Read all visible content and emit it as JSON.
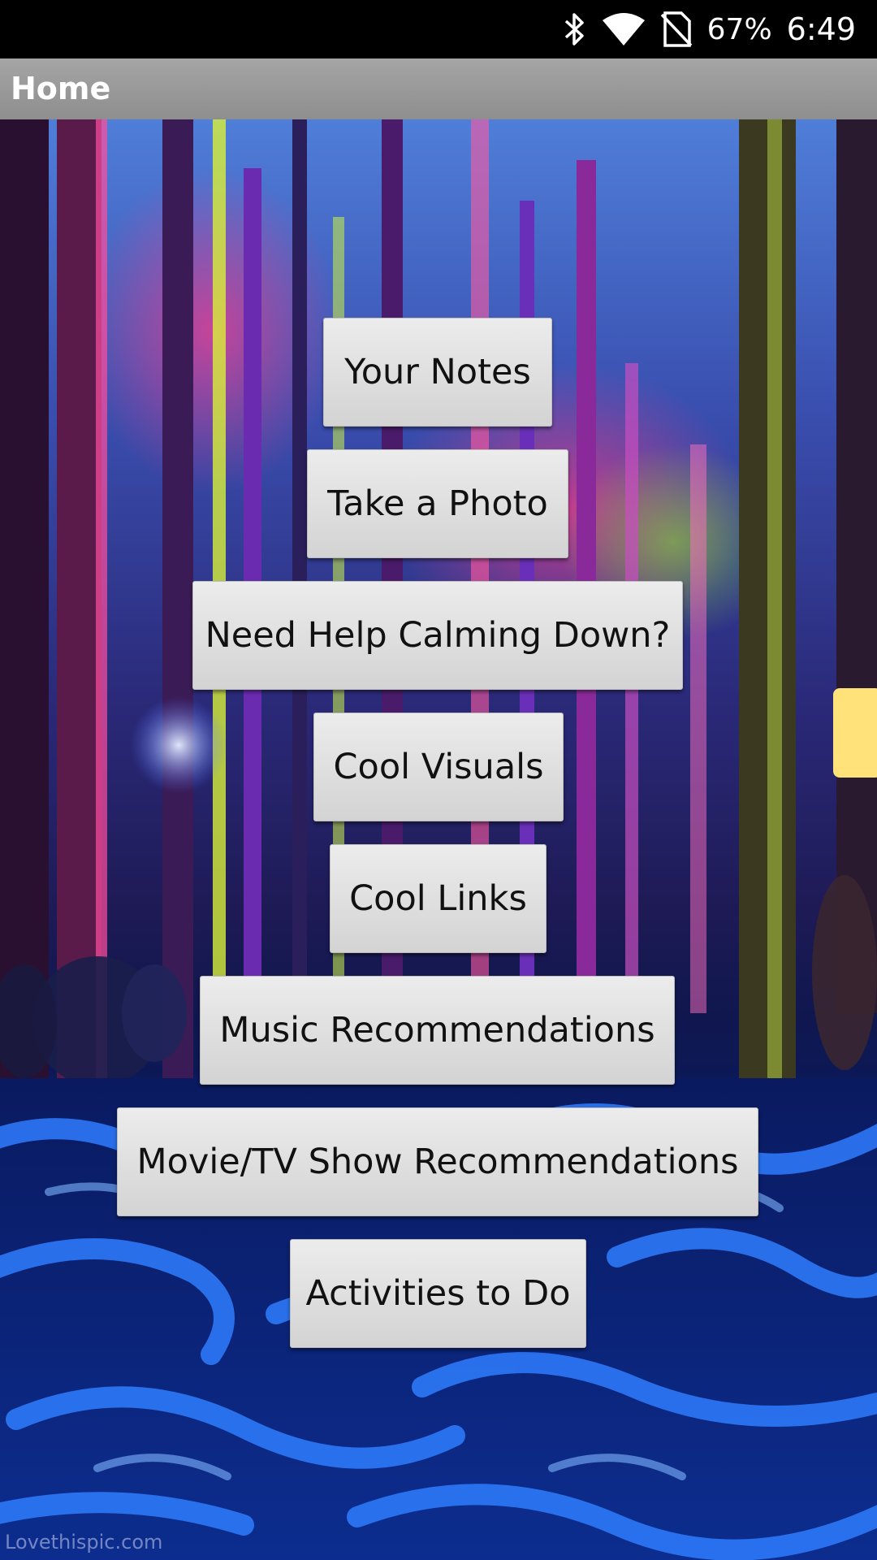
{
  "status_bar": {
    "battery_percent": "67%",
    "time": "6:49",
    "icons": [
      "bluetooth-icon",
      "wifi-icon",
      "no-sim-icon"
    ]
  },
  "action_bar": {
    "title": "Home"
  },
  "menu": {
    "buttons": [
      {
        "label": "Your Notes"
      },
      {
        "label": "Take a Photo"
      },
      {
        "label": "Need Help Calming Down?"
      },
      {
        "label": "Cool Visuals"
      },
      {
        "label": "Cool Links"
      },
      {
        "label": "Music Recommendations"
      },
      {
        "label": "Movie/TV Show Recommendations"
      },
      {
        "label": "Activities to Do"
      }
    ]
  },
  "background": {
    "watermark": "Lovethispic.com"
  }
}
